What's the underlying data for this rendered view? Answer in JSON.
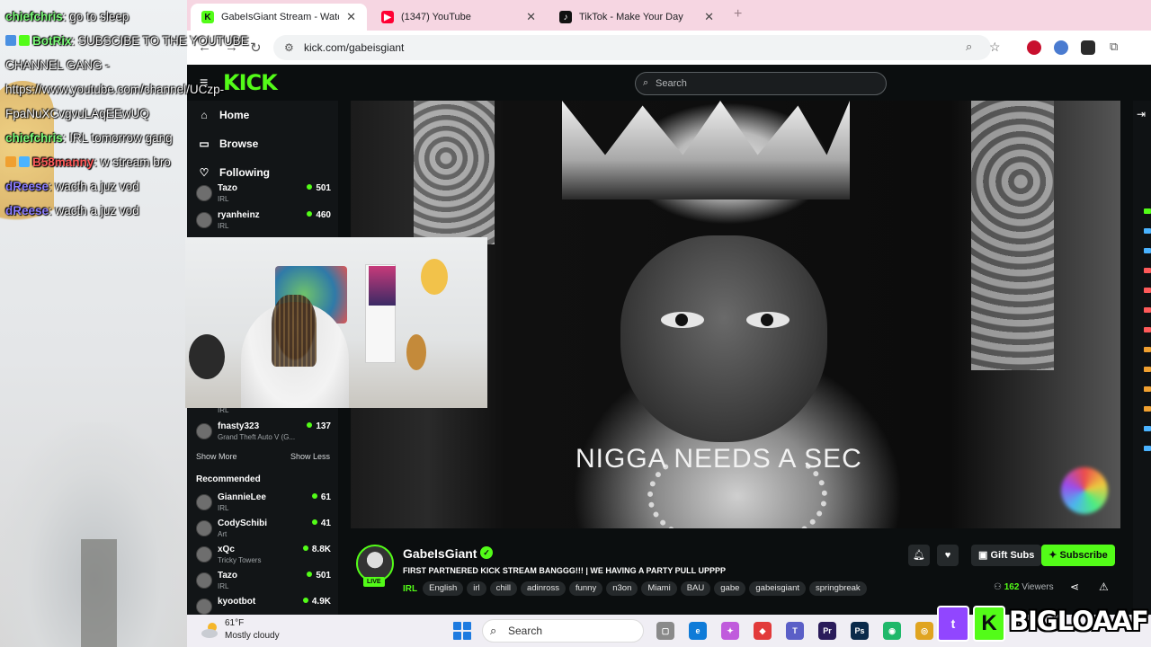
{
  "browser": {
    "tabs": [
      {
        "title": "GabeIsGiant Stream - Watch Li",
        "favicon": "kick-icon",
        "color": "#53fc18",
        "glyph": "K",
        "active": true
      },
      {
        "title": "(1347) YouTube",
        "favicon": "youtube-icon",
        "color": "#ff0033",
        "glyph": "▶",
        "active": false
      },
      {
        "title": "TikTok - Make Your Day",
        "favicon": "tiktok-icon",
        "color": "#111111",
        "glyph": "♪",
        "active": false
      }
    ],
    "new_tab": "+",
    "url": "kick.com/gabeisgiant"
  },
  "kick": {
    "logo": "KICK",
    "search_placeholder": "Search",
    "nav": [
      {
        "label": "Home",
        "icon": "home-icon",
        "glyph": "⌂"
      },
      {
        "label": "Browse",
        "icon": "browse-icon",
        "glyph": "▭"
      },
      {
        "label": "Following",
        "icon": "heart-icon",
        "glyph": "♡"
      }
    ],
    "following": [
      {
        "name": "Tazo",
        "category": "IRL",
        "viewers": "501"
      },
      {
        "name": "ryanheinz",
        "category": "IRL",
        "viewers": "460"
      },
      {
        "name": "fnasty323",
        "category": "Grand Theft Auto V (G...",
        "viewers": "137"
      }
    ],
    "partial_category": "IRL",
    "show_more": "Show More",
    "show_less": "Show Less",
    "recommended_heading": "Recommended",
    "recommended": [
      {
        "name": "GiannieLee",
        "category": "IRL",
        "viewers": "61"
      },
      {
        "name": "CodySchibi",
        "category": "Art",
        "viewers": "41"
      },
      {
        "name": "xQc",
        "category": "Tricky Towers",
        "viewers": "8.8K"
      },
      {
        "name": "Tazo",
        "category": "IRL",
        "viewers": "501"
      },
      {
        "name": "kyootbot",
        "category": "",
        "viewers": "4.9K"
      }
    ],
    "overlay_text": "NIGGA NEEDS A SEC",
    "channel": {
      "name": "GabeIsGiant",
      "live_badge": "LIVE",
      "title": "FIRST PARTNERED KICK STREAM BANGGG!!! | WE HAVING A PARTY PULL UPPPP",
      "category": "IRL",
      "tags": [
        "English",
        "irl",
        "chill",
        "adinross",
        "funny",
        "n3on",
        "Miami",
        "BAU",
        "gabe",
        "gabeisgiant",
        "springbreak"
      ],
      "gift_label": "Gift Subs",
      "subscribe_label": "Subscribe",
      "viewers_count": "162",
      "viewers_label": "Viewers"
    }
  },
  "chat": [
    {
      "user": "chiefchris",
      "message": " go to sleep",
      "style": "green"
    },
    {
      "user": "BotRix",
      "message": " SUBSCIBE TO THE YOUTUBE",
      "style": "green"
    },
    {
      "user": "",
      "message": "CHANNEL GANG -",
      "style": "none"
    },
    {
      "user": "",
      "message": "https://www.youtube.com/channel/UCzp-",
      "style": "none"
    },
    {
      "user": "",
      "message": "FpaNuXCvgvuLAqEEwUQ",
      "style": "none"
    },
    {
      "user": "chiefchris",
      "message": " IRL tomorrow gang",
      "style": "green"
    },
    {
      "user": "B58manny",
      "message": " w stream bro",
      "style": "red"
    },
    {
      "user": "dReese",
      "message": " wacth a juz vod",
      "style": "blue"
    },
    {
      "user": "dReese",
      "message": " wacth a juz vod",
      "style": "blue"
    }
  ],
  "taskbar": {
    "temperature": "61°F",
    "weather": "Mostly cloudy",
    "search_placeholder": "Search",
    "apps": [
      {
        "name": "task-view-icon",
        "color": "#8a8a8a",
        "glyph": "▢"
      },
      {
        "name": "edge-icon",
        "color": "#0f7bd8",
        "glyph": "e"
      },
      {
        "name": "copilot-icon",
        "color": "#c05bdc",
        "glyph": "✦"
      },
      {
        "name": "app-red-icon",
        "color": "#e23a3a",
        "glyph": "◆"
      },
      {
        "name": "teams-icon",
        "color": "#5b5fc7",
        "glyph": "T"
      },
      {
        "name": "premiere-icon",
        "color": "#2a1b5a",
        "glyph": "Pr"
      },
      {
        "name": "photoshop-icon",
        "color": "#0a2a4a",
        "glyph": "Ps"
      },
      {
        "name": "green-app-icon",
        "color": "#1fb86a",
        "glyph": "◉"
      },
      {
        "name": "chrome-icon",
        "color": "#e0a420",
        "glyph": "◎"
      }
    ]
  },
  "watermark": {
    "twitch_glyph": "t",
    "kick_glyph": "K",
    "name": "BIGLOAAF"
  },
  "colors": {
    "kick_green": "#53fc18",
    "twitch_purple": "#9146ff"
  }
}
